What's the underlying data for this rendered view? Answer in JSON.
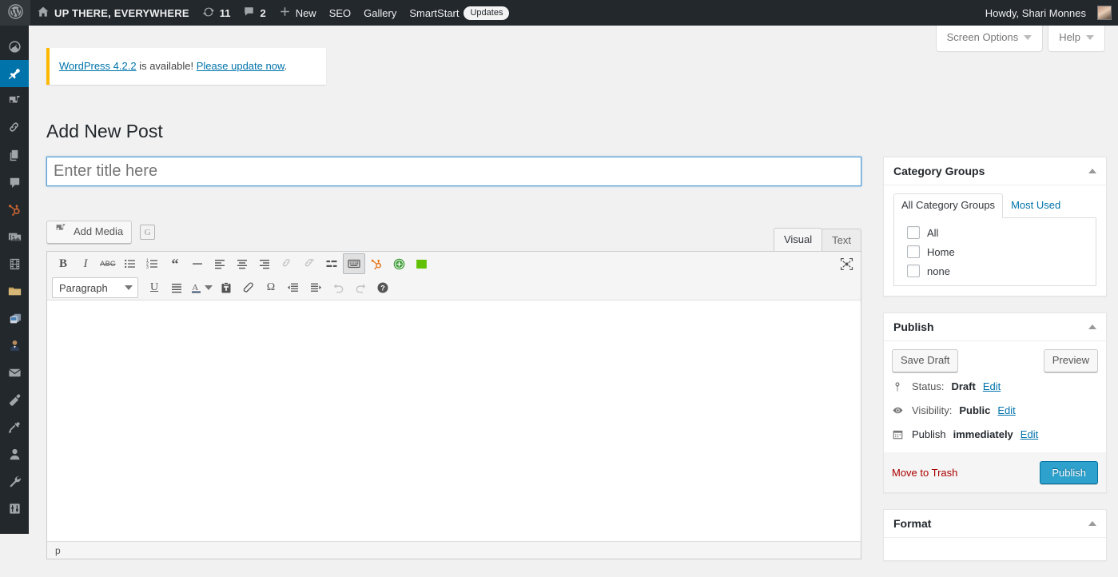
{
  "adminbar": {
    "wp_logo": "wordpress-logo-icon",
    "site_name": "UP THERE, EVERYWHERE",
    "updates_icon": "updates-icon",
    "updates_count": "11",
    "comments_icon": "comment-bubble-icon",
    "comments_count": "2",
    "new_label": "New",
    "seo_label": "SEO",
    "gallery_label": "Gallery",
    "smartstart_label": "SmartStart",
    "smartstart_badge": "Updates",
    "howdy": "Howdy, Shari Monnes"
  },
  "adminmenu": {
    "items": [
      {
        "name": "dashboard",
        "icon": "dashboard-gauge-icon",
        "current": false
      },
      {
        "name": "posts",
        "icon": "pushpin-icon",
        "current": true
      },
      {
        "name": "media",
        "icon": "media-music-photo-icon",
        "current": false
      },
      {
        "name": "links",
        "icon": "chain-link-icon",
        "current": false
      },
      {
        "name": "pages",
        "icon": "pages-icon",
        "current": false
      },
      {
        "name": "comments",
        "icon": "comment-bubble-icon",
        "current": false
      },
      {
        "name": "hubspot",
        "icon": "hubspot-sprocket-icon",
        "current": false
      },
      {
        "name": "gallery",
        "icon": "images-stack-icon",
        "current": false
      },
      {
        "name": "video",
        "icon": "film-strip-icon",
        "current": false
      },
      {
        "name": "files",
        "icon": "folder-icon",
        "current": false
      },
      {
        "name": "slides",
        "icon": "cards-stack-icon",
        "current": false
      },
      {
        "name": "profiles",
        "icon": "person-suit-icon",
        "current": false
      },
      {
        "name": "mail",
        "icon": "envelope-icon",
        "current": false
      },
      {
        "name": "appearance",
        "icon": "paintbrush-icon",
        "current": false
      },
      {
        "name": "plugins",
        "icon": "plug-icon",
        "current": false
      },
      {
        "name": "users",
        "icon": "user-icon",
        "current": false
      },
      {
        "name": "tools",
        "icon": "wrench-icon",
        "current": false
      },
      {
        "name": "settings",
        "icon": "settings-sliders-icon",
        "current": false
      }
    ]
  },
  "screen_meta": {
    "screen_options": "Screen Options",
    "help": "Help"
  },
  "update_nag": {
    "version_link": "WordPress 4.2.2",
    "middle_text": " is available! ",
    "update_link": "Please update now",
    "trailing": "."
  },
  "page": {
    "title": "Add New Post"
  },
  "title_field": {
    "value": "",
    "placeholder": "Enter title here"
  },
  "editor": {
    "add_media_label": "Add Media",
    "add_media_icon": "add-media-icon",
    "grammarly_label": "G",
    "tabs": [
      {
        "label": "Visual",
        "active": true
      },
      {
        "label": "Text",
        "active": false
      }
    ],
    "toolbar_row1": [
      {
        "name": "bold-icon",
        "glyph": "B",
        "state": "normal"
      },
      {
        "name": "italic-icon",
        "glyph": "I",
        "state": "normal"
      },
      {
        "name": "strikethrough-icon",
        "glyph": "ABC",
        "state": "normal"
      },
      {
        "name": "bulleted-list-icon",
        "glyph": "",
        "state": "normal"
      },
      {
        "name": "numbered-list-icon",
        "glyph": "",
        "state": "normal"
      },
      {
        "name": "blockquote-icon",
        "glyph": "“",
        "state": "normal"
      },
      {
        "name": "horizontal-rule-icon",
        "glyph": "",
        "state": "normal"
      },
      {
        "name": "align-left-icon",
        "glyph": "",
        "state": "normal"
      },
      {
        "name": "align-center-icon",
        "glyph": "",
        "state": "normal"
      },
      {
        "name": "align-right-icon",
        "glyph": "",
        "state": "normal"
      },
      {
        "name": "insert-link-icon",
        "glyph": "",
        "state": "disabled"
      },
      {
        "name": "remove-link-icon",
        "glyph": "",
        "state": "disabled"
      },
      {
        "name": "read-more-icon",
        "glyph": "",
        "state": "normal"
      },
      {
        "name": "toggle-toolbar-icon",
        "glyph": "",
        "state": "active"
      },
      {
        "name": "hubspot-sprocket-icon",
        "glyph": "",
        "state": "normal"
      },
      {
        "name": "add-green-circle-icon",
        "glyph": "",
        "state": "normal"
      },
      {
        "name": "green-square-icon",
        "glyph": "",
        "state": "normal"
      }
    ],
    "toolbar_row2": [
      {
        "name": "underline-icon",
        "glyph": "U",
        "state": "normal"
      },
      {
        "name": "justify-icon",
        "glyph": "",
        "state": "normal"
      },
      {
        "name": "text-color-icon",
        "glyph": "A",
        "state": "normal"
      },
      {
        "name": "paste-as-text-icon",
        "glyph": "",
        "state": "normal"
      },
      {
        "name": "clear-formatting-icon",
        "glyph": "",
        "state": "normal"
      },
      {
        "name": "special-character-icon",
        "glyph": "Ω",
        "state": "normal"
      },
      {
        "name": "outdent-icon",
        "glyph": "",
        "state": "normal"
      },
      {
        "name": "indent-icon",
        "glyph": "",
        "state": "normal"
      },
      {
        "name": "undo-icon",
        "glyph": "",
        "state": "disabled"
      },
      {
        "name": "redo-icon",
        "glyph": "",
        "state": "disabled"
      },
      {
        "name": "keyboard-shortcuts-help-icon",
        "glyph": "?",
        "state": "normal"
      }
    ],
    "format_select": "Paragraph",
    "fullscreen_icon": "distraction-free-writing-icon",
    "content": "",
    "statusbar_path": "p"
  },
  "sidebar": {
    "category_groups": {
      "title": "Category Groups",
      "toggle_icon": "chevron-up-icon",
      "tabs": [
        {
          "label": "All Category Groups",
          "active": true
        },
        {
          "label": "Most Used",
          "active": false
        }
      ],
      "items": [
        {
          "label": "All",
          "checked": false
        },
        {
          "label": "Home",
          "checked": false
        },
        {
          "label": "none",
          "checked": false
        }
      ]
    },
    "publish": {
      "title": "Publish",
      "toggle_icon": "chevron-up-icon",
      "save_draft": "Save Draft",
      "preview": "Preview",
      "status_icon": "pin-marker-icon",
      "status_label": "Status:",
      "status_value": "Draft",
      "status_edit": "Edit",
      "visibility_icon": "eye-icon",
      "visibility_label": "Visibility:",
      "visibility_value": "Public",
      "visibility_edit": "Edit",
      "schedule_icon": "calendar-icon",
      "schedule_label": "Publish",
      "schedule_value": "immediately",
      "schedule_edit": "Edit",
      "trash": "Move to Trash",
      "publish_button": "Publish"
    },
    "format": {
      "title": "Format",
      "toggle_icon": "chevron-up-icon"
    }
  },
  "colors": {
    "adminbar_bg": "#23282d",
    "menu_current": "#0073aa",
    "link": "#0073aa",
    "primary_button": "#2ea2cc",
    "nag_accent": "#ffb900",
    "trash_red": "#a00",
    "hubspot_orange": "#cc6633",
    "green_square": "#5ec000"
  }
}
